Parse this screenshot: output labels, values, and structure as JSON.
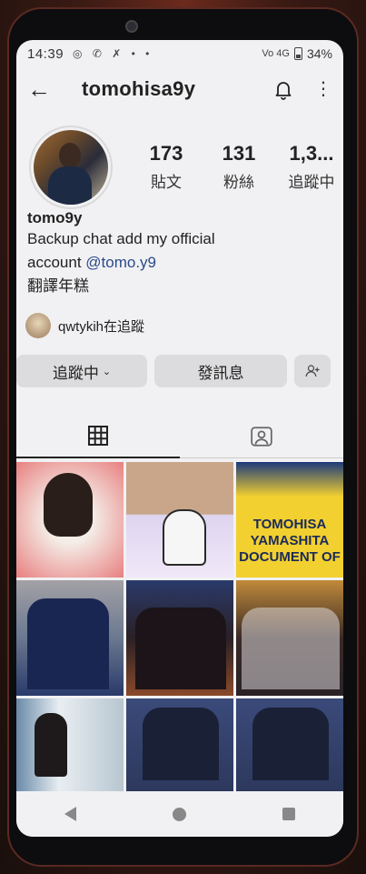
{
  "status_bar": {
    "time": "14:39",
    "notification_icons": "◎ ✆ ✗ • •",
    "network": "Vo 4G",
    "battery": "34%"
  },
  "header": {
    "title": "tomohisa9y",
    "back_icon": "arrow-left",
    "bell_icon": "bell",
    "more_icon": "⋮"
  },
  "profile": {
    "stats": [
      {
        "value": "173",
        "label": "貼文"
      },
      {
        "value": "131",
        "label": "粉絲"
      },
      {
        "value": "1,3...",
        "label": "追蹤中"
      }
    ],
    "display_name": "tomo9y",
    "bio_line_1": "Backup chat add my official",
    "bio_line_2_prefix": "account ",
    "bio_mention": "@tomo.y9",
    "bio_line_3": "翻譯年糕",
    "followed_by": "qwtykih在追蹤"
  },
  "buttons": {
    "following": "追蹤中",
    "following_chevron": "⌄",
    "message": "發訊息",
    "add_user_icon": "add-user"
  },
  "tabs": {
    "grid_icon": "grid",
    "tagged_icon": "tagged-person"
  },
  "posts": {
    "p3_text": "TOMOHISA YAMASHITA DOCUMENT OF"
  },
  "colors": {
    "background": "#f1f1f3",
    "button": "#dcdcde",
    "text": "#222222"
  }
}
